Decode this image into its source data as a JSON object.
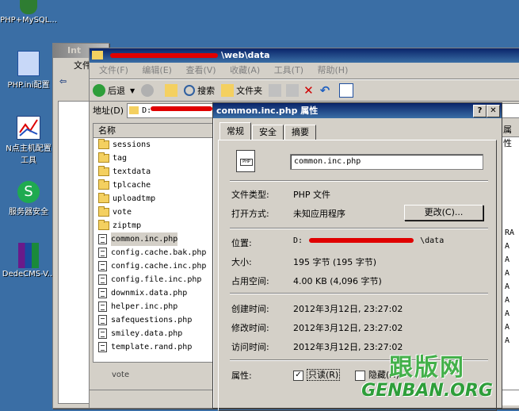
{
  "desktop": {
    "icons": [
      {
        "label": "PHP+MySQL..."
      },
      {
        "label": "PHP.ini配置"
      },
      {
        "label": "N点主机配置"
      },
      {
        "label": "工具"
      },
      {
        "label": "服务器安全"
      },
      {
        "label": "DedeCMS-V..."
      }
    ]
  },
  "back_window": {
    "title_prefix": "Int",
    "menu_label": "文件"
  },
  "explorer": {
    "title_suffix": "\\web\\data",
    "menu": [
      "文件(F)",
      "编辑(E)",
      "查看(V)",
      "收藏(A)",
      "工具(T)",
      "帮助(H)"
    ],
    "toolbar": {
      "back": "后退",
      "search": "搜索",
      "folders": "文件夹"
    },
    "address_label": "地址(D)",
    "address_prefix": "D:",
    "column_name": "名称",
    "right_column": "属性",
    "files": [
      {
        "name": "sessions",
        "type": "folder"
      },
      {
        "name": "tag",
        "type": "folder"
      },
      {
        "name": "textdata",
        "type": "folder"
      },
      {
        "name": "tplcache",
        "type": "folder"
      },
      {
        "name": "uploadtmp",
        "type": "folder"
      },
      {
        "name": "vote",
        "type": "folder"
      },
      {
        "name": "ziptmp",
        "type": "folder"
      },
      {
        "name": "common.inc.php",
        "type": "file"
      },
      {
        "name": "config.cache.bak.php",
        "type": "file"
      },
      {
        "name": "config.cache.inc.php",
        "type": "file"
      },
      {
        "name": "config.file.inc.php",
        "type": "file"
      },
      {
        "name": "downmix.data.php",
        "type": "file"
      },
      {
        "name": "helper.inc.php",
        "type": "file"
      },
      {
        "name": "safequestions.php",
        "type": "file"
      },
      {
        "name": "smiley.data.php",
        "type": "file"
      },
      {
        "name": "template.rand.php",
        "type": "file"
      }
    ],
    "attrs": [
      "RA",
      "A",
      "A",
      "A",
      "A",
      "A",
      "A",
      "A",
      "A"
    ],
    "tree_bottom": "vote"
  },
  "dialog": {
    "title": "common.inc.php 属性",
    "help_btn": "?",
    "close_btn": "✕",
    "tabs": [
      "常规",
      "安全",
      "摘要"
    ],
    "filename": "common.inc.php",
    "file_type_label": "文件类型:",
    "file_type_value": "PHP 文件",
    "open_with_label": "打开方式:",
    "open_with_value": "未知应用程序",
    "change_button": "更改(C)...",
    "location_label": "位置:",
    "location_prefix": "D:",
    "location_suffix": "\\data",
    "size_label": "大小:",
    "size_value": "195 字节 (195 字节)",
    "disk_label": "占用空间:",
    "disk_value": "4.00 KB (4,096 字节)",
    "created_label": "创建时间:",
    "created_value": "2012年3月12日, 23:27:02",
    "modified_label": "修改时间:",
    "modified_value": "2012年3月12日, 23:27:02",
    "accessed_label": "访问时间:",
    "accessed_value": "2012年3月12日, 23:27:02",
    "attr_label": "属性:",
    "readonly_label": "只读(R)",
    "hidden_label": "隐藏(H)"
  },
  "watermark": {
    "cn": "跟版网",
    "en": "GENBAN.ORG"
  }
}
